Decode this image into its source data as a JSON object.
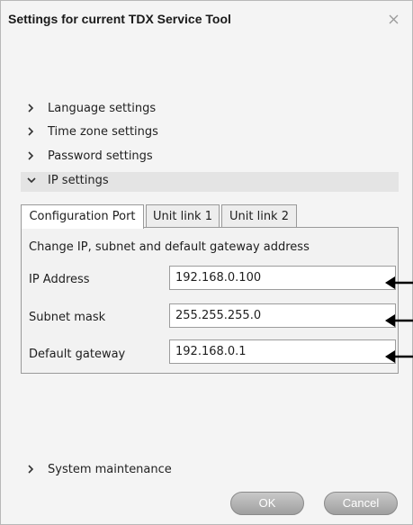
{
  "dialog": {
    "title": "Settings for current TDX Service Tool",
    "close_icon": "close-icon"
  },
  "sections": [
    {
      "label": "Language settings",
      "expanded": false
    },
    {
      "label": "Time zone settings",
      "expanded": false
    },
    {
      "label": "Password settings",
      "expanded": false
    },
    {
      "label": "IP settings",
      "expanded": true
    }
  ],
  "tabs": [
    {
      "label": "Configuration Port",
      "active": true
    },
    {
      "label": "Unit link 1",
      "active": false
    },
    {
      "label": "Unit link 2",
      "active": false
    }
  ],
  "panel": {
    "heading": "Change IP, subnet and default gateway address",
    "fields": [
      {
        "label": "IP Address",
        "value": "192.168.0.100"
      },
      {
        "label": "Subnet mask",
        "value": "255.255.255.0"
      },
      {
        "label": "Default gateway",
        "value": "192.168.0.1"
      }
    ]
  },
  "footer_section": {
    "label": "System maintenance",
    "expanded": false
  },
  "buttons": {
    "ok": "OK",
    "cancel": "Cancel"
  },
  "colors": {
    "expanded_row": "#e4e4e4",
    "button": "#b0b0b0",
    "arrow": "#000000"
  }
}
